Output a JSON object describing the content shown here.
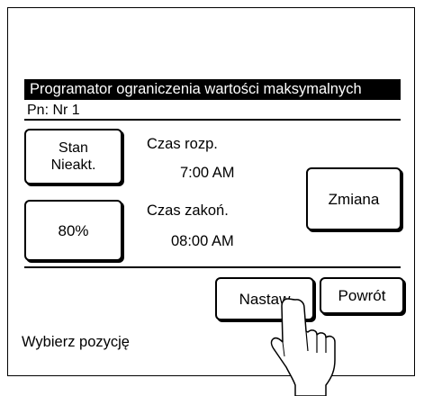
{
  "screen": {
    "title": "Programator ograniczenia wartości maksymalnych",
    "program_label": "Pn: Nr 1"
  },
  "left_buttons": {
    "status_line1": "Stan",
    "status_line2": "Nieakt.",
    "limit_value": "80%"
  },
  "times": {
    "start_label": "Czas rozp.",
    "start_value": "7:00  AM",
    "end_label": "Czas zakoń.",
    "end_value": "08:00  AM"
  },
  "actions": {
    "change_label": "Zmiana",
    "set_label": "Nastaw",
    "back_label": "Powrót"
  },
  "status_text": "Wybierz pozycję",
  "icons": {
    "pointer": "pointing-hand-icon"
  },
  "colors": {
    "title_bar_bg": "#000000",
    "title_bar_text": "#ffffff",
    "background": "#ffffff"
  }
}
